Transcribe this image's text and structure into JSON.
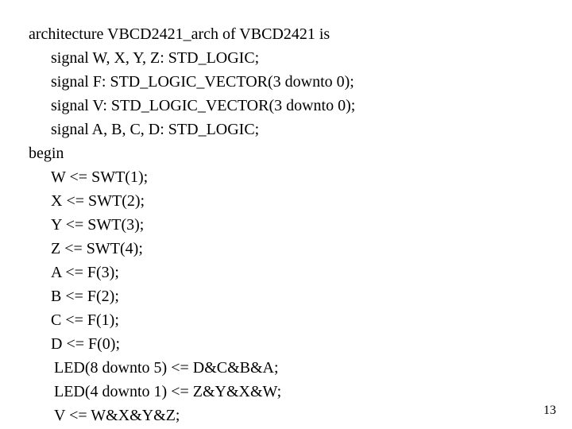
{
  "code": {
    "l1": "architecture VBCD2421_arch of VBCD2421 is",
    "l2": "signal W, X, Y, Z: STD_LOGIC;",
    "l3": "signal F: STD_LOGIC_VECTOR(3 downto 0);",
    "l4": "signal V: STD_LOGIC_VECTOR(3 downto 0);",
    "l5": "signal A, B, C, D: STD_LOGIC;",
    "l6": "begin",
    "l7": "W <= SWT(1);",
    "l8": "X <= SWT(2);",
    "l9": "Y <= SWT(3);",
    "l10": "Z <= SWT(4);",
    "l11": "A <= F(3);",
    "l12": "B <= F(2);",
    "l13": "C <= F(1);",
    "l14": "D <= F(0);",
    "l15": "LED(8 downto 5) <= D&C&B&A;",
    "l16": "LED(4 downto 1) <= Z&Y&X&W;",
    "l17": "V <= W&X&Y&Z;"
  },
  "page_number": "13"
}
